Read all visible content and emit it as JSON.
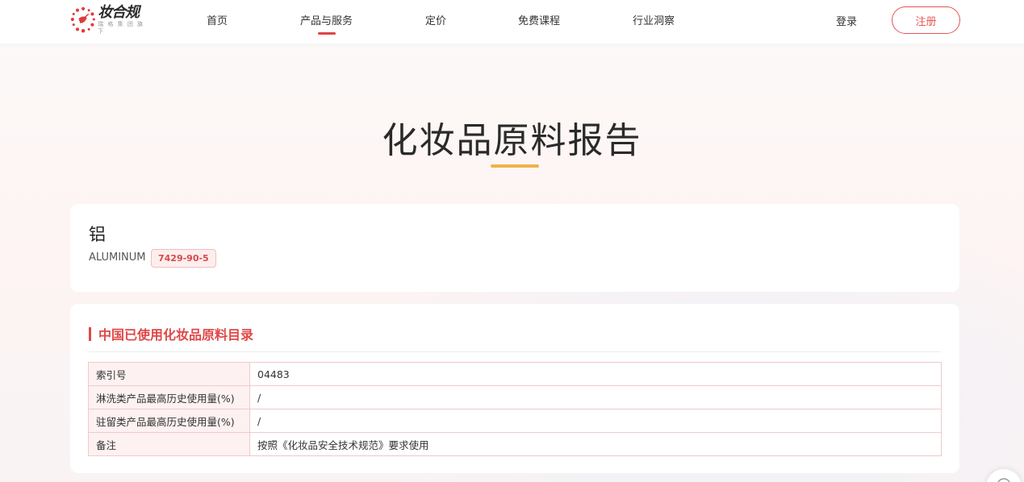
{
  "header": {
    "logo": {
      "name": "妆合规",
      "subtitle": "瑞 格 集 团 旗 下"
    },
    "nav": [
      {
        "label": "首页"
      },
      {
        "label": "产品与服务",
        "active": true
      },
      {
        "label": "定价"
      },
      {
        "label": "免费课程"
      },
      {
        "label": "行业洞察"
      }
    ],
    "login_label": "登录",
    "register_label": "注册"
  },
  "page": {
    "title": "化妆品原料报告"
  },
  "ingredient": {
    "name_cn": "铝",
    "name_en": "ALUMINUM",
    "cas": "7429-90-5"
  },
  "catalog": {
    "title": "中国已使用化妆品原料目录",
    "rows": [
      {
        "key": "索引号",
        "value": "04483"
      },
      {
        "key": "淋洗类产品最高历史使用量(%)",
        "value": "/"
      },
      {
        "key": "驻留类产品最高历史使用量(%)",
        "value": "/"
      },
      {
        "key": "备注",
        "value": "按照《化妆品安全技术规范》要求使用"
      }
    ]
  },
  "colors": {
    "accent_red": "#e04848",
    "title_underline": "#f0b24a",
    "table_border": "#f1c9c9"
  },
  "icons": {
    "logo": "logo-dots-icon",
    "float": "chat-icon"
  }
}
